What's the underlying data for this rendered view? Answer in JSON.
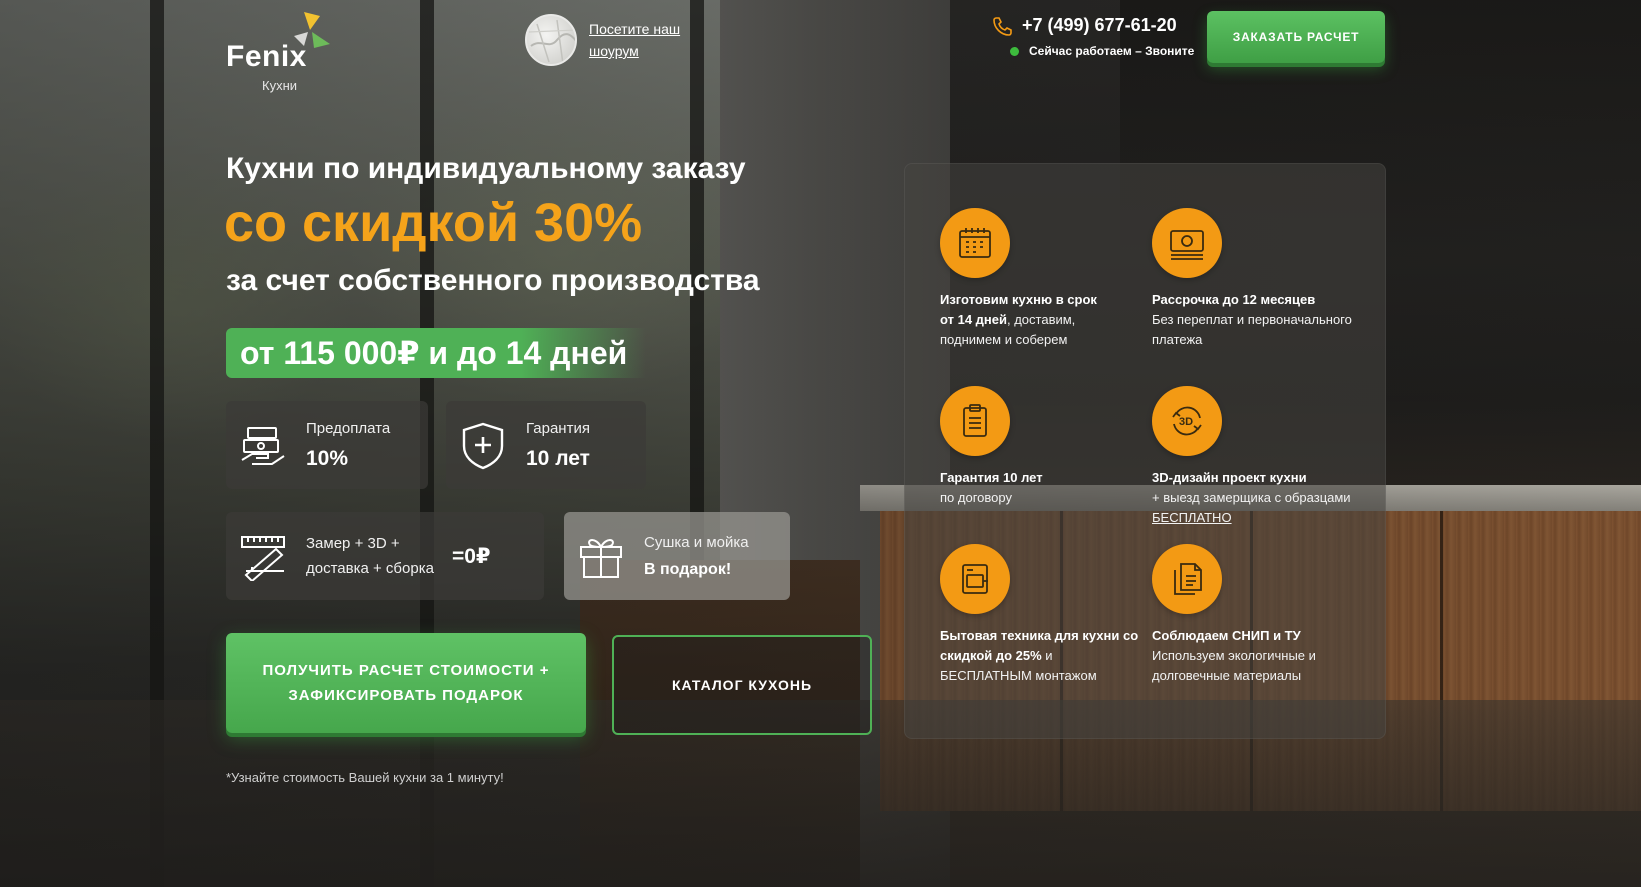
{
  "header": {
    "logo_name": "Fenix",
    "logo_sub": "Кухни",
    "showroom_link": "Посетите наш шоурум",
    "phone": "+7 (499) 677-61-20",
    "status": "Сейчас работаем – Звоните",
    "order_button": "ЗАКАЗАТЬ РАСЧЕТ"
  },
  "hero": {
    "line1": "Кухни по индивидуальному заказу",
    "line2": "со скидкой 30%",
    "line3": "за счет собственного производства",
    "price_pill": "от 115 000₽ и до 14 дней"
  },
  "cards": {
    "prepay_label": "Предоплата",
    "prepay_value": "10%",
    "guarantee_label": "Гарантия",
    "guarantee_value": "10 лет",
    "measure_line1": "Замер + 3D +",
    "measure_line2": "доставка + сборка",
    "measure_value": "=0₽",
    "gift_label": "Сушка и мойка",
    "gift_value": "В подарок!"
  },
  "cta": {
    "primary": "ПОЛУЧИТЬ РАСЧЕТ СТОИМОСТИ + ЗАФИКСИРОВАТЬ ПОДАРОК",
    "catalog": "КАТАЛОГ КУХОНЬ",
    "note": "*Узнайте стоимость Вашей кухни за 1 минуту!"
  },
  "benefits": [
    {
      "icon": "calendar-icon",
      "bold1": "Изготовим кухню в срок",
      "bold2": "от 14 дней",
      "rest": ", доставим, поднимем и соберем"
    },
    {
      "icon": "money-icon",
      "bold1": "Рассрочка до 12 месяцев",
      "rest": "Без переплат и первоначального платежа"
    },
    {
      "icon": "clipboard-icon",
      "bold1": "Гарантия 10 лет",
      "rest": "по договору"
    },
    {
      "icon": "3d-rotate-icon",
      "bold1": "3D-дизайн проект кухни",
      "rest": "+ выезд замерщика с образцами ",
      "link": "БЕСПЛАТНО"
    },
    {
      "icon": "appliance-icon",
      "bold1": "Бытовая техника для кухни со скидкой до 25%",
      "rest": " и БЕСПЛАТНЫМ монтажом"
    },
    {
      "icon": "document-icon",
      "bold1": "Соблюдаем СНИП и ТУ",
      "rest": "Используем экологичные и долговечные материалы"
    }
  ],
  "colors": {
    "accent_orange": "#f5a31a",
    "green": "#4fb156",
    "icon_circle": "#f39a14"
  }
}
